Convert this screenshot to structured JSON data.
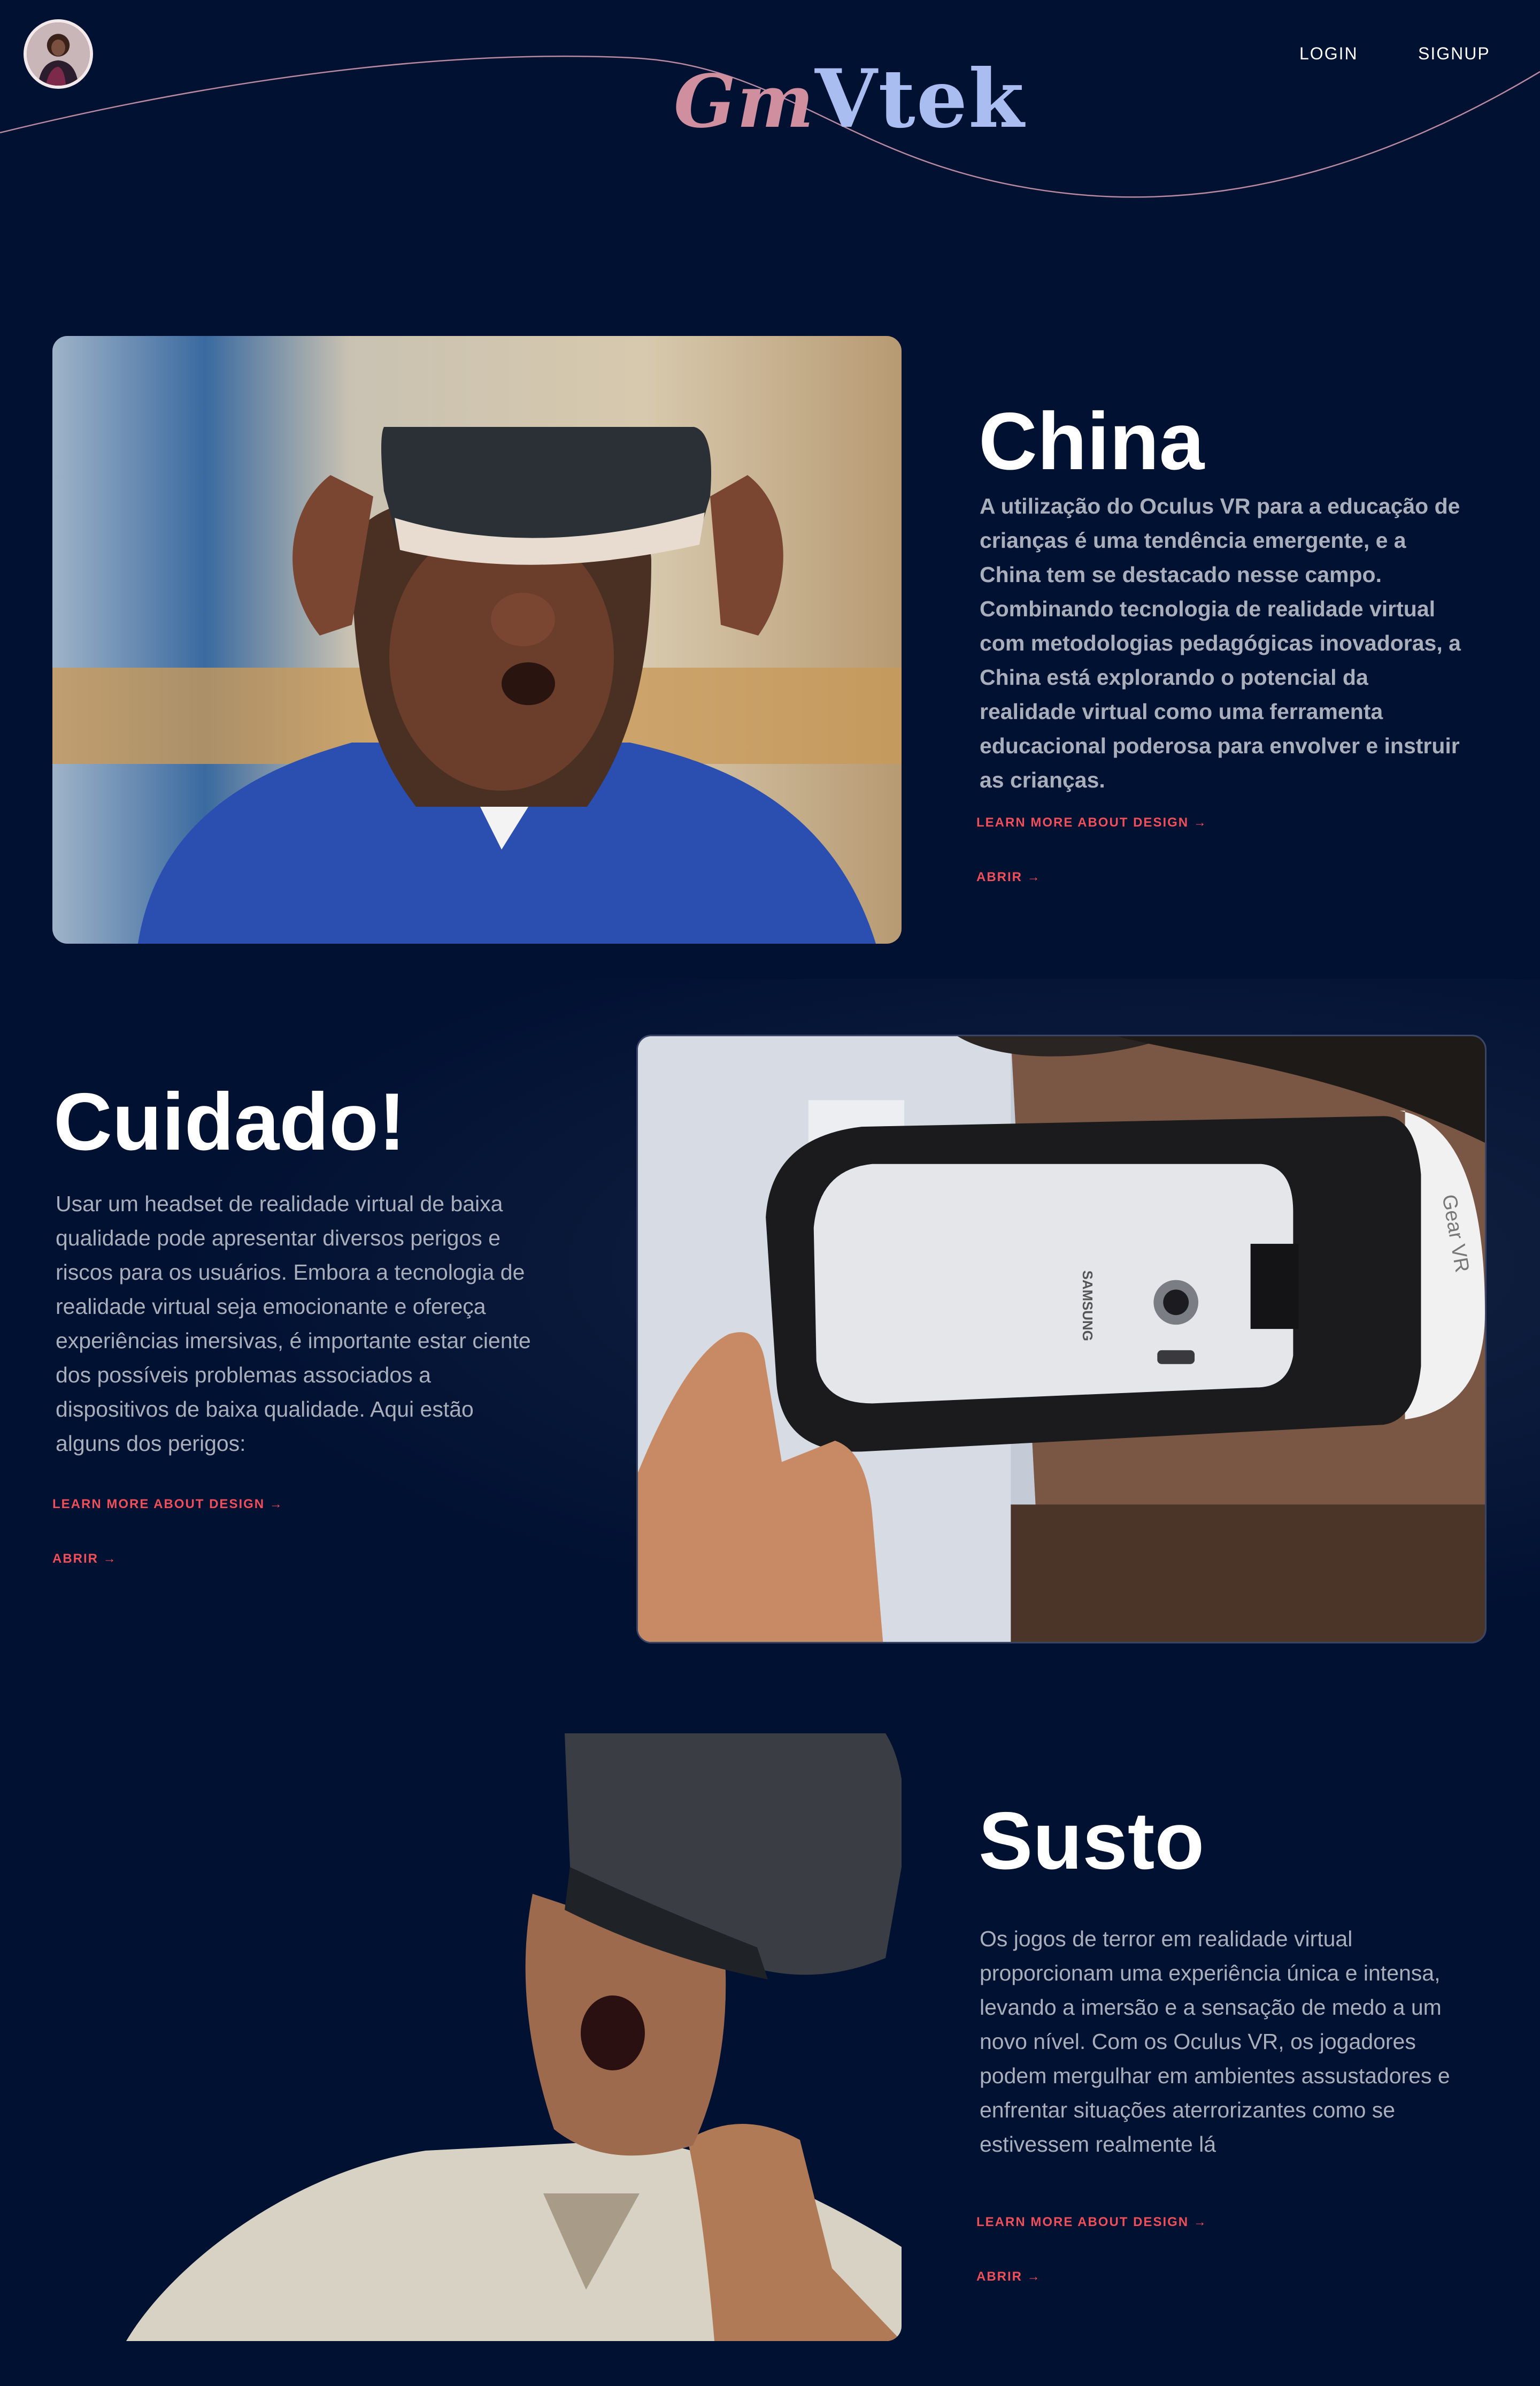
{
  "header": {
    "logo_part1": "Gm",
    "logo_part2": "Vtek",
    "nav": {
      "login": "LOGIN",
      "signup": "SIGNUP"
    }
  },
  "sections": [
    {
      "title": "China",
      "body": "A utilização do Oculus VR para a educação de crianças é uma tendência emergente, e a China tem se destacado nesse campo. Combinando tecnologia de realidade virtual com metodologias pedagógicas inovadoras, a China está explorando o potencial da realidade virtual como uma ferramenta educacional poderosa para envolver e instruir as crianças.",
      "learn_more": "LEARN MORE ABOUT DESIGN →",
      "open": "ABRIR →"
    },
    {
      "title": "Cuidado!",
      "body": "Usar um headset de realidade virtual de baixa qualidade pode apresentar diversos perigos e riscos para os usuários. Embora a tecnologia de realidade virtual seja emocionante e ofereça experiências imersivas, é importante estar ciente dos possíveis problemas associados a dispositivos de baixa qualidade. Aqui estão alguns dos perigos:",
      "learn_more": "LEARN MORE ABOUT DESIGN →",
      "open": "ABRIR →",
      "phone_brand": "SAMSUNG",
      "headset_brand": "Gear VR"
    },
    {
      "title": "Susto",
      "body": "Os jogos de terror em realidade virtual proporcionam uma experiência única e intensa, levando a imersão e a sensação de medo a um novo nível. Com os Oculus VR, os jogadores podem mergulhar em ambientes assustadores e enfrentar situações aterrorizantes como se estivessem realmente lá",
      "learn_more": "LEARN MORE ABOUT DESIGN →",
      "open": "ABRIR →"
    }
  ],
  "colors": {
    "background": "#011132",
    "link": "#f04f5a",
    "logo_gm": "#cf8f9e",
    "logo_vtek": "#a9bdf0",
    "body_text": "#a9aebb"
  }
}
